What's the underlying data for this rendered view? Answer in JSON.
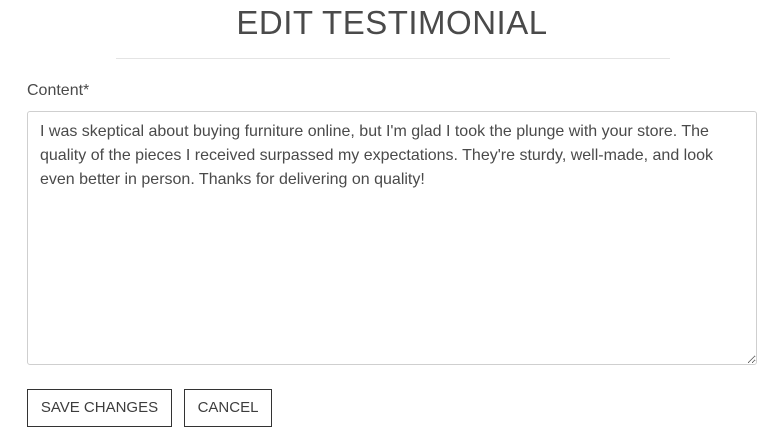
{
  "page": {
    "title": "EDIT TESTIMONIAL"
  },
  "form": {
    "content_label": "Content*",
    "content_value": "I was skeptical about buying furniture online, but I'm glad I took the plunge with your store. The quality of the pieces I received surpassed my expectations. They're sturdy, well-made, and look even better in person. Thanks for delivering on quality!"
  },
  "actions": {
    "save_label": "SAVE CHANGES",
    "cancel_label": "CANCEL"
  }
}
